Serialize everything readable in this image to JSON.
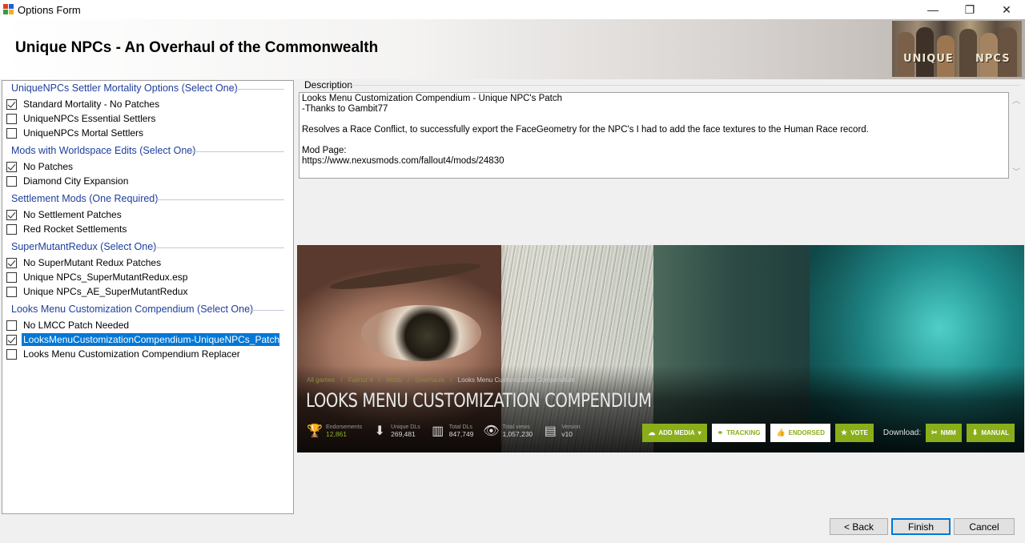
{
  "window": {
    "title": "Options Form",
    "controls": {
      "minimize": "—",
      "maximize": "❐",
      "close": "✕"
    }
  },
  "header": {
    "title": "Unique NPCs - An Overhaul of the Commonwealth",
    "logo_text_left": "UNIQUE",
    "logo_text_right": "NPCS"
  },
  "groups": [
    {
      "title": "UniqueNPCs Settler Mortality Options (Select One)",
      "options": [
        {
          "label": "Standard Mortality - No Patches",
          "checked": true
        },
        {
          "label": "UniqueNPCs Essential Settlers",
          "checked": false
        },
        {
          "label": "UniqueNPCs Mortal Settlers",
          "checked": false
        }
      ]
    },
    {
      "title": "Mods with Worldspace Edits (Select One)",
      "options": [
        {
          "label": "No Patches",
          "checked": true
        },
        {
          "label": "Diamond City Expansion",
          "checked": false
        }
      ]
    },
    {
      "title": "Settlement Mods (One Required)",
      "options": [
        {
          "label": "No Settlement Patches",
          "checked": true
        },
        {
          "label": "Red Rocket Settlements",
          "checked": false
        }
      ]
    },
    {
      "title": "SuperMutantRedux (Select One)",
      "options": [
        {
          "label": "No SuperMutant Redux Patches",
          "checked": true
        },
        {
          "label": "Unique NPCs_SuperMutantRedux.esp",
          "checked": false
        },
        {
          "label": "Unique NPCs_AE_SuperMutantRedux",
          "checked": false
        }
      ]
    },
    {
      "title": "Looks Menu Customization Compendium (Select One)",
      "options": [
        {
          "label": "No LMCC Patch Needed",
          "checked": false
        },
        {
          "label": "LooksMenuCustomizationCompendium-UniqueNPCs_Patch",
          "checked": true,
          "selected": true
        },
        {
          "label": "Looks Menu Customization Compendium Replacer",
          "checked": false
        }
      ]
    }
  ],
  "description": {
    "label": "Description",
    "text": "Looks Menu Customization Compendium - Unique NPC's Patch\n-Thanks to Gambit77\n\nResolves a Race Conflict, to successfully export the FaceGeometry for the NPC's I had to add the face textures to the Human Race record.\n\nMod Page:\nhttps://www.nexusmods.com/fallout4/mods/24830"
  },
  "preview": {
    "breadcrumbs": [
      "All games",
      "/",
      "Fallout 4",
      "/",
      "Mods",
      "/",
      "Overhauls",
      "/"
    ],
    "breadcrumb_current": "Looks Menu Customization Compendium",
    "mod_title": "LOOKS MENU CUSTOMIZATION COMPENDIUM",
    "stats": [
      {
        "icon": "trophy-icon",
        "glyph": "🏆",
        "label": "Endorsements",
        "value": "12,861",
        "accent": true
      },
      {
        "icon": "download-icon",
        "glyph": "⬇",
        "label": "Unique DLs",
        "value": "269,481",
        "accent": false
      },
      {
        "icon": "bar-chart-icon",
        "glyph": "▥",
        "label": "Total DLs",
        "value": "847,749",
        "accent": false
      },
      {
        "icon": "eye-icon",
        "glyph": "👁",
        "label": "Total views",
        "value": "1,057,230",
        "accent": false
      },
      {
        "icon": "file-icon",
        "glyph": "▤",
        "label": "Version",
        "value": "v10",
        "accent": false
      }
    ],
    "actions": {
      "add_media": "ADD MEDIA",
      "tracking": "TRACKING",
      "endorsed": "ENDORSED",
      "vote": "VOTE",
      "download_label": "Download:",
      "nmm": "NMM",
      "manual": "MANUAL"
    },
    "colors": {
      "accent": "#8aae1a"
    }
  },
  "buttons": {
    "back": "< Back",
    "finish": "Finish",
    "cancel": "Cancel"
  },
  "colors": {
    "group_header": "#1f3e9c",
    "selection": "#0078d7"
  }
}
